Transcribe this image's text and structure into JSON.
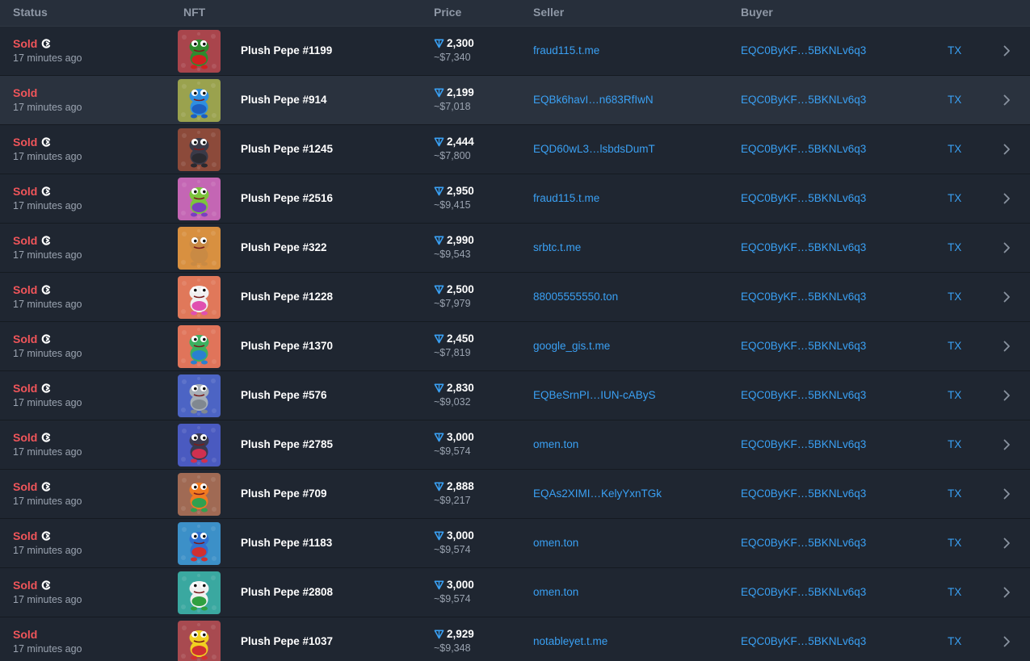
{
  "columns": {
    "status": "Status",
    "nft": "NFT",
    "price": "Price",
    "seller": "Seller",
    "buyer": "Buyer"
  },
  "colors": {
    "background": "#1f2631",
    "header": "#272f3b",
    "sold": "#f0555a",
    "link": "#3aa0f3",
    "muted": "#9aa3b0"
  },
  "rows": [
    {
      "status": "Sold",
      "time": "17 minutes ago",
      "marketplace_icon": true,
      "name": "Plush Pepe #1199",
      "ton": "2,300",
      "usd": "~$7,340",
      "seller": "fraud115.t.me",
      "buyer": "EQC0ByKF…5BKNLv6q3",
      "tx": "TX",
      "bg": "#a9454c",
      "pepe": "#2e8b2e",
      "outfit": "#d02020"
    },
    {
      "status": "Sold",
      "time": "17 minutes ago",
      "marketplace_icon": false,
      "name": "Plush Pepe #914",
      "ton": "2,199",
      "usd": "~$7,018",
      "seller": "EQBk6havI…n683RfIwN",
      "buyer": "EQC0ByKF…5BKNLv6q3",
      "tx": "TX",
      "bg": "#9aa24e",
      "pepe": "#2f8fe0",
      "outfit": "#1d5fc0"
    },
    {
      "status": "Sold",
      "time": "17 minutes ago",
      "marketplace_icon": true,
      "name": "Plush Pepe #1245",
      "ton": "2,444",
      "usd": "~$7,800",
      "seller": "EQD60wL3…lsbdsDumT",
      "buyer": "EQC0ByKF…5BKNLv6q3",
      "tx": "TX",
      "bg": "#8c4a3a",
      "pepe": "#3a3a48",
      "outfit": "#2a2a30"
    },
    {
      "status": "Sold",
      "time": "17 minutes ago",
      "marketplace_icon": true,
      "name": "Plush Pepe #2516",
      "ton": "2,950",
      "usd": "~$9,415",
      "seller": "fraud115.t.me",
      "buyer": "EQC0ByKF…5BKNLv6q3",
      "tx": "TX",
      "bg": "#c466b4",
      "pepe": "#7cc43c",
      "outfit": "#7a3fc0"
    },
    {
      "status": "Sold",
      "time": "17 minutes ago",
      "marketplace_icon": true,
      "name": "Plush Pepe #322",
      "ton": "2,990",
      "usd": "~$9,543",
      "seller": "srbtc.t.me",
      "buyer": "EQC0ByKF…5BKNLv6q3",
      "tx": "TX",
      "bg": "#d89040",
      "pepe": "#c98a44",
      "outfit": "#c98a44"
    },
    {
      "status": "Sold",
      "time": "17 minutes ago",
      "marketplace_icon": true,
      "name": "Plush Pepe #1228",
      "ton": "2,500",
      "usd": "~$7,979",
      "seller": "88005555550.ton",
      "buyer": "EQC0ByKF…5BKNLv6q3",
      "tx": "TX",
      "bg": "#e0785a",
      "pepe": "#f0f0f0",
      "outfit": "#e050b0"
    },
    {
      "status": "Sold",
      "time": "17 minutes ago",
      "marketplace_icon": true,
      "name": "Plush Pepe #1370",
      "ton": "2,450",
      "usd": "~$7,819",
      "seller": "google_gis.t.me",
      "buyer": "EQC0ByKF…5BKNLv6q3",
      "tx": "TX",
      "bg": "#e0745a",
      "pepe": "#3cb060",
      "outfit": "#2a80d0"
    },
    {
      "status": "Sold",
      "time": "17 minutes ago",
      "marketplace_icon": true,
      "name": "Plush Pepe #576",
      "ton": "2,830",
      "usd": "~$9,032",
      "seller": "EQBeSrnPI…IUN-cAByS",
      "buyer": "EQC0ByKF…5BKNLv6q3",
      "tx": "TX",
      "bg": "#4c64c4",
      "pepe": "#a8b0b8",
      "outfit": "#808890"
    },
    {
      "status": "Sold",
      "time": "17 minutes ago",
      "marketplace_icon": true,
      "name": "Plush Pepe #2785",
      "ton": "3,000",
      "usd": "~$9,574",
      "seller": "omen.ton",
      "buyer": "EQC0ByKF…5BKNLv6q3",
      "tx": "TX",
      "bg": "#4a5ac0",
      "pepe": "#3a3a50",
      "outfit": "#d03050"
    },
    {
      "status": "Sold",
      "time": "17 minutes ago",
      "marketplace_icon": true,
      "name": "Plush Pepe #709",
      "ton": "2,888",
      "usd": "~$9,217",
      "seller": "EQAs2XIMI…KelyYxnTGk",
      "buyer": "EQC0ByKF…5BKNLv6q3",
      "tx": "TX",
      "bg": "#a06a54",
      "pepe": "#f07a20",
      "outfit": "#30a050"
    },
    {
      "status": "Sold",
      "time": "17 minutes ago",
      "marketplace_icon": true,
      "name": "Plush Pepe #1183",
      "ton": "3,000",
      "usd": "~$9,574",
      "seller": "omen.ton",
      "buyer": "EQC0ByKF…5BKNLv6q3",
      "tx": "TX",
      "bg": "#3c90c8",
      "pepe": "#3070d0",
      "outfit": "#d03030"
    },
    {
      "status": "Sold",
      "time": "17 minutes ago",
      "marketplace_icon": true,
      "name": "Plush Pepe #2808",
      "ton": "3,000",
      "usd": "~$9,574",
      "seller": "omen.ton",
      "buyer": "EQC0ByKF…5BKNLv6q3",
      "tx": "TX",
      "bg": "#3aa8a0",
      "pepe": "#f0f0f0",
      "outfit": "#30a040"
    },
    {
      "status": "Sold",
      "time": "17 minutes ago",
      "marketplace_icon": false,
      "name": "Plush Pepe #1037",
      "ton": "2,929",
      "usd": "~$9,348",
      "seller": "notableyet.t.me",
      "buyer": "EQC0ByKF…5BKNLv6q3",
      "tx": "TX",
      "bg": "#a84a50",
      "pepe": "#f0d020",
      "outfit": "#d03030"
    }
  ]
}
